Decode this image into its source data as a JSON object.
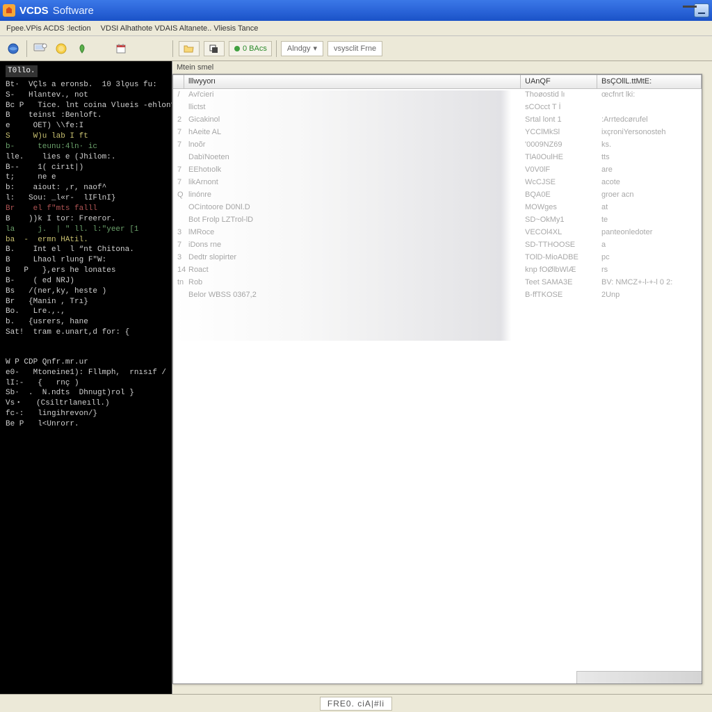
{
  "window": {
    "title_main": "VCDS",
    "title_sub": "Software"
  },
  "menu": {
    "items": [
      "Fpee.VPis ACDS :lection",
      "VDSI Alhathote VDAIS Altanete.. Vliesis Tance"
    ]
  },
  "toolbar": {
    "left_icons": [
      "globe",
      "monitor",
      "coin",
      "leaf",
      "calendar"
    ],
    "right_buttons": [
      {
        "icon": "folder-open",
        "label": ""
      },
      {
        "icon": "layers",
        "label": ""
      },
      {
        "icon": "record",
        "label": "0 BAcs"
      }
    ],
    "drops": [
      {
        "label": "Alndgy",
        "chevron": true
      },
      {
        "label": "vsysclit Frne"
      }
    ]
  },
  "left_console": {
    "header": "T0llo.",
    "lines": [
      "Bt·  VÇls a eronsb.  10 3lǫus fu:",
      "S-   Hlantev., not",
      "Bc P   Tice. lnt coina Vlueis -ehlon?",
      "B    teinst :Benloft.",
      "e     OET) \\\\fe:I",
      "S     W)u lab I ft",
      "b-     teunu:4ln· ic",
      "lle.    lies e (Jhilom:.",
      "B--    1( cirıt|)",
      "t;     ‫ne e",
      "b:    aiout: ,r, naof^",
      "l:   Sou: _l«r-  lIFlnI}",
      "Br    el f\"mts falll",
      "B    ))k I tor: Freeror.",
      "la     j.  | \" ll. l:\"yeer [1",
      "ba  -  ermn HAtil.",
      "B.    Int el  l “nt Chitona.",
      "B     Lhaol rlung F\"W:",
      "B   P   },ers he lonates",
      "B-    ( ed NRJ)",
      "Bs   /(ner,ky, heste )",
      "Br   {Manin , Trı}",
      "Bo.   Lre.,.,",
      "b.   {usrers, hane",
      "Sat!  tram e.unart,d for: {"
    ],
    "section2_header": "W P CDP Qnfr.mr.ur",
    "section2_lines": [
      "e0-   Mtoneine1): Fllmph,  rnısıf /",
      "lI:-   {   rnç )",
      "Sb·  .  N.ndts  Dhnugt)rol }",
      "Vs・   (Csiltrlaneıll.)",
      "fc-:   lingihrevon/}",
      "Be P   l<Unrorr."
    ]
  },
  "panel": {
    "label": "Mtein smel",
    "columns": [
      "",
      "lllwyyorı",
      "UAnQF",
      "BsÇOllL.ttMtE:"
    ],
    "rows": [
      {
        "a": "/",
        "b": "Avřcieri",
        "c": "Thoøostid lı",
        "d": "œcfnrt lki:"
      },
      {
        "a": "",
        "b": "llictst",
        "c": "sCOcct T İ",
        "d": ""
      },
      {
        "a": "2",
        "b": "Gicakinol",
        "c": "Srtal lont 1",
        "d": ":Arrtedcørufel"
      },
      {
        "a": "7",
        "b": "hAeite AL",
        "c": "YCClMkSl",
        "d": "ixçroniYersonosteh"
      },
      {
        "a": "7",
        "b": "lnoõr",
        "c": "'0009NZ69",
        "d": "ks."
      },
      {
        "a": "",
        "b": "DabïNoeten",
        "c": "TlA0OulHE",
        "d": "tts"
      },
      {
        "a": "7",
        "b": "EEhotıolk",
        "c": "V0V0lF",
        "d": "are"
      },
      {
        "a": "7",
        "b": "likArnont",
        "c": "WcCJSE",
        "d": "acote"
      },
      {
        "a": "Q",
        "b": "linónre",
        "c": "BQA0E",
        "d": "groer  acn"
      },
      {
        "a": "",
        "b": "OCintoore  D0Nl.D",
        "c": "MOWges",
        "d": "at"
      },
      {
        "a": "",
        "b": "Bot Frolp  LZTrol-lD",
        "c": "SD~OkMy1",
        "d": "te"
      },
      {
        "a": "3",
        "b": "lMRoce",
        "c": "VECOl4XL",
        "d": "panteonledoter"
      },
      {
        "a": "7",
        "b": "iDons rne",
        "c": "SD-TTHOOSE",
        "d": "a"
      },
      {
        "a": "3",
        "b": "Dedtr slopirter",
        "c": "TOlD-MioADBE",
        "d": "pc"
      },
      {
        "a": "14",
        "b": "Roact",
        "c": "knp fOØlbWlÆ",
        "d": "rs"
      },
      {
        "a": "tn",
        "b": "Rob",
        "c": "Teet  SAMA3E",
        "d": "BV: NMCZ+-l-+-l 0 2:"
      },
      {
        "a": "",
        "b": "Belor  WBSS  0367,2",
        "c": "B-ffTKOSE",
        "d": "2Unp"
      }
    ]
  },
  "statusbar": {
    "text": "FRE0. ciA|#li"
  }
}
